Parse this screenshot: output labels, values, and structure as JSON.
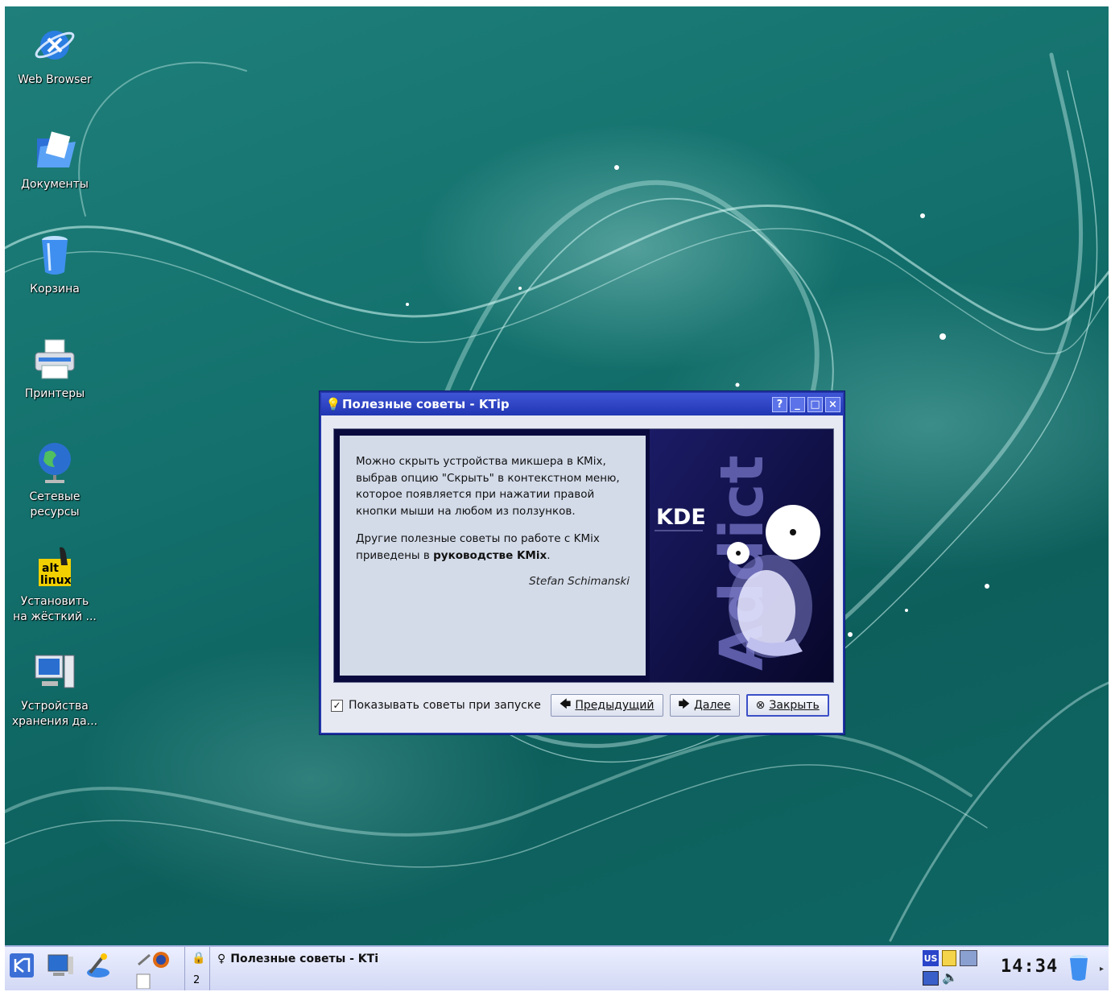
{
  "desktop_icons": [
    {
      "label": "Web Browser",
      "icon": "web-browser-icon"
    },
    {
      "label": "Документы",
      "icon": "folder-icon"
    },
    {
      "label": "Корзина",
      "icon": "trash-icon"
    },
    {
      "label": "Принтеры",
      "icon": "printer-icon"
    },
    {
      "label_lines": [
        "Сетевые",
        "ресурсы"
      ],
      "icon": "network-globe-icon"
    },
    {
      "label_lines": [
        "Установить",
        "на жёсткий ..."
      ],
      "icon": "alt-linux-installer-icon",
      "logo_text": "alt linux"
    },
    {
      "label_lines": [
        "Устройства",
        "хранения да..."
      ],
      "icon": "computer-storage-icon"
    }
  ],
  "dialog": {
    "title": "Полезные советы - KTip",
    "title_buttons": [
      "?",
      "_",
      "□",
      "×"
    ],
    "tip_lines_1": [
      "Можно скрыть устройства микшера в KMix,",
      "выбрав опцию \"Скрыть\" в контекстном меню,",
      "которое появляется при нажатии правой",
      "кнопки мыши на любом из ползунков."
    ],
    "tip_line_2a": "Другие полезные советы по работе с KMix",
    "tip_line_2b_prefix": "приведены в ",
    "tip_line_2b_link": "руководстве KMix",
    "tip_line_2b_suffix": ".",
    "author": "Stefan Schimanski",
    "image_text": {
      "kde": "KDE",
      "addict": "Addict"
    },
    "checkbox_label": "Показывать советы при запуске",
    "checkbox_checked": true,
    "btn_prev_label": "Предыдущий",
    "btn_next_label": "Далее",
    "btn_close_label": "Закрыть"
  },
  "taskbar": {
    "task_label": "Полезные советы - KTi",
    "pager_number": "2",
    "keyboard_layout": "US",
    "clock": "14:34"
  },
  "colors": {
    "desktop": "#13706c",
    "titlebar": "#2136b3",
    "taskbar": "#e0e5f8"
  }
}
